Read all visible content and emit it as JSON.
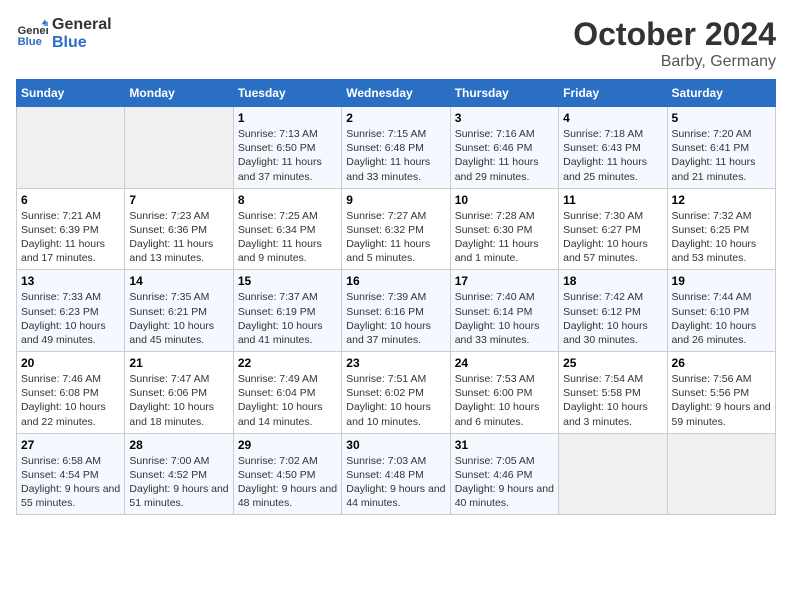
{
  "header": {
    "logo_line1": "General",
    "logo_line2": "Blue",
    "month": "October 2024",
    "location": "Barby, Germany"
  },
  "weekdays": [
    "Sunday",
    "Monday",
    "Tuesday",
    "Wednesday",
    "Thursday",
    "Friday",
    "Saturday"
  ],
  "weeks": [
    [
      {
        "day": "",
        "info": ""
      },
      {
        "day": "",
        "info": ""
      },
      {
        "day": "1",
        "info": "Sunrise: 7:13 AM\nSunset: 6:50 PM\nDaylight: 11 hours and 37 minutes."
      },
      {
        "day": "2",
        "info": "Sunrise: 7:15 AM\nSunset: 6:48 PM\nDaylight: 11 hours and 33 minutes."
      },
      {
        "day": "3",
        "info": "Sunrise: 7:16 AM\nSunset: 6:46 PM\nDaylight: 11 hours and 29 minutes."
      },
      {
        "day": "4",
        "info": "Sunrise: 7:18 AM\nSunset: 6:43 PM\nDaylight: 11 hours and 25 minutes."
      },
      {
        "day": "5",
        "info": "Sunrise: 7:20 AM\nSunset: 6:41 PM\nDaylight: 11 hours and 21 minutes."
      }
    ],
    [
      {
        "day": "6",
        "info": "Sunrise: 7:21 AM\nSunset: 6:39 PM\nDaylight: 11 hours and 17 minutes."
      },
      {
        "day": "7",
        "info": "Sunrise: 7:23 AM\nSunset: 6:36 PM\nDaylight: 11 hours and 13 minutes."
      },
      {
        "day": "8",
        "info": "Sunrise: 7:25 AM\nSunset: 6:34 PM\nDaylight: 11 hours and 9 minutes."
      },
      {
        "day": "9",
        "info": "Sunrise: 7:27 AM\nSunset: 6:32 PM\nDaylight: 11 hours and 5 minutes."
      },
      {
        "day": "10",
        "info": "Sunrise: 7:28 AM\nSunset: 6:30 PM\nDaylight: 11 hours and 1 minute."
      },
      {
        "day": "11",
        "info": "Sunrise: 7:30 AM\nSunset: 6:27 PM\nDaylight: 10 hours and 57 minutes."
      },
      {
        "day": "12",
        "info": "Sunrise: 7:32 AM\nSunset: 6:25 PM\nDaylight: 10 hours and 53 minutes."
      }
    ],
    [
      {
        "day": "13",
        "info": "Sunrise: 7:33 AM\nSunset: 6:23 PM\nDaylight: 10 hours and 49 minutes."
      },
      {
        "day": "14",
        "info": "Sunrise: 7:35 AM\nSunset: 6:21 PM\nDaylight: 10 hours and 45 minutes."
      },
      {
        "day": "15",
        "info": "Sunrise: 7:37 AM\nSunset: 6:19 PM\nDaylight: 10 hours and 41 minutes."
      },
      {
        "day": "16",
        "info": "Sunrise: 7:39 AM\nSunset: 6:16 PM\nDaylight: 10 hours and 37 minutes."
      },
      {
        "day": "17",
        "info": "Sunrise: 7:40 AM\nSunset: 6:14 PM\nDaylight: 10 hours and 33 minutes."
      },
      {
        "day": "18",
        "info": "Sunrise: 7:42 AM\nSunset: 6:12 PM\nDaylight: 10 hours and 30 minutes."
      },
      {
        "day": "19",
        "info": "Sunrise: 7:44 AM\nSunset: 6:10 PM\nDaylight: 10 hours and 26 minutes."
      }
    ],
    [
      {
        "day": "20",
        "info": "Sunrise: 7:46 AM\nSunset: 6:08 PM\nDaylight: 10 hours and 22 minutes."
      },
      {
        "day": "21",
        "info": "Sunrise: 7:47 AM\nSunset: 6:06 PM\nDaylight: 10 hours and 18 minutes."
      },
      {
        "day": "22",
        "info": "Sunrise: 7:49 AM\nSunset: 6:04 PM\nDaylight: 10 hours and 14 minutes."
      },
      {
        "day": "23",
        "info": "Sunrise: 7:51 AM\nSunset: 6:02 PM\nDaylight: 10 hours and 10 minutes."
      },
      {
        "day": "24",
        "info": "Sunrise: 7:53 AM\nSunset: 6:00 PM\nDaylight: 10 hours and 6 minutes."
      },
      {
        "day": "25",
        "info": "Sunrise: 7:54 AM\nSunset: 5:58 PM\nDaylight: 10 hours and 3 minutes."
      },
      {
        "day": "26",
        "info": "Sunrise: 7:56 AM\nSunset: 5:56 PM\nDaylight: 9 hours and 59 minutes."
      }
    ],
    [
      {
        "day": "27",
        "info": "Sunrise: 6:58 AM\nSunset: 4:54 PM\nDaylight: 9 hours and 55 minutes."
      },
      {
        "day": "28",
        "info": "Sunrise: 7:00 AM\nSunset: 4:52 PM\nDaylight: 9 hours and 51 minutes."
      },
      {
        "day": "29",
        "info": "Sunrise: 7:02 AM\nSunset: 4:50 PM\nDaylight: 9 hours and 48 minutes."
      },
      {
        "day": "30",
        "info": "Sunrise: 7:03 AM\nSunset: 4:48 PM\nDaylight: 9 hours and 44 minutes."
      },
      {
        "day": "31",
        "info": "Sunrise: 7:05 AM\nSunset: 4:46 PM\nDaylight: 9 hours and 40 minutes."
      },
      {
        "day": "",
        "info": ""
      },
      {
        "day": "",
        "info": ""
      }
    ]
  ]
}
